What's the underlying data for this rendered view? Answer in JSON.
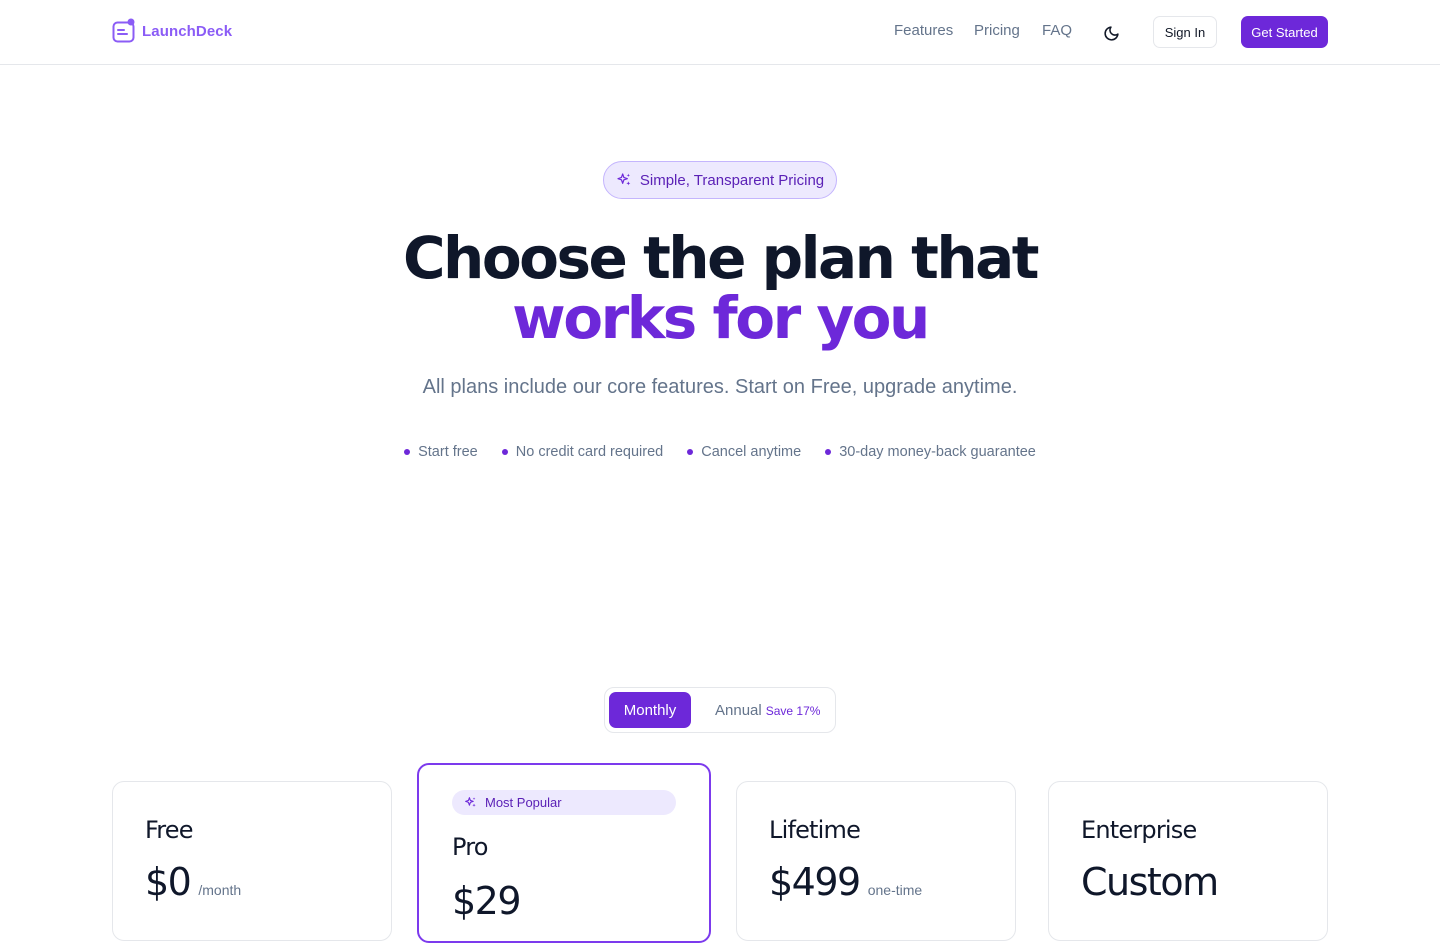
{
  "brand": {
    "name": "LaunchDeck",
    "accent": "#6d28d9",
    "logo_color": "#8b5cf6"
  },
  "nav": {
    "links": [
      "Features",
      "Pricing",
      "FAQ"
    ],
    "theme_icon": "moon-icon",
    "sign_in": "Sign In",
    "get_started": "Get Started"
  },
  "hero": {
    "pill_icon": "sparkles-icon",
    "pill": "Simple, Transparent Pricing",
    "title_line1": "Choose the plan that",
    "title_line2": "works for you",
    "subtitle": "All plans include our core features. Start on Free, upgrade anytime.",
    "bullets": [
      "Start free",
      "No credit card required",
      "Cancel anytime",
      "30-day money-back guarantee"
    ]
  },
  "billing_toggle": {
    "monthly": "Monthly",
    "annual": "Annual",
    "save": "Save 17%",
    "selected": "Monthly"
  },
  "plans": [
    {
      "name": "Free",
      "price": "$0",
      "unit": "/month"
    },
    {
      "name": "Pro",
      "badge": "Most Popular",
      "badge_icon": "sparkles-icon",
      "price": "$29",
      "unit": ""
    },
    {
      "name": "Lifetime",
      "price": "$499",
      "unit": "one-time"
    },
    {
      "name": "Enterprise",
      "price": "Custom",
      "unit": ""
    }
  ]
}
